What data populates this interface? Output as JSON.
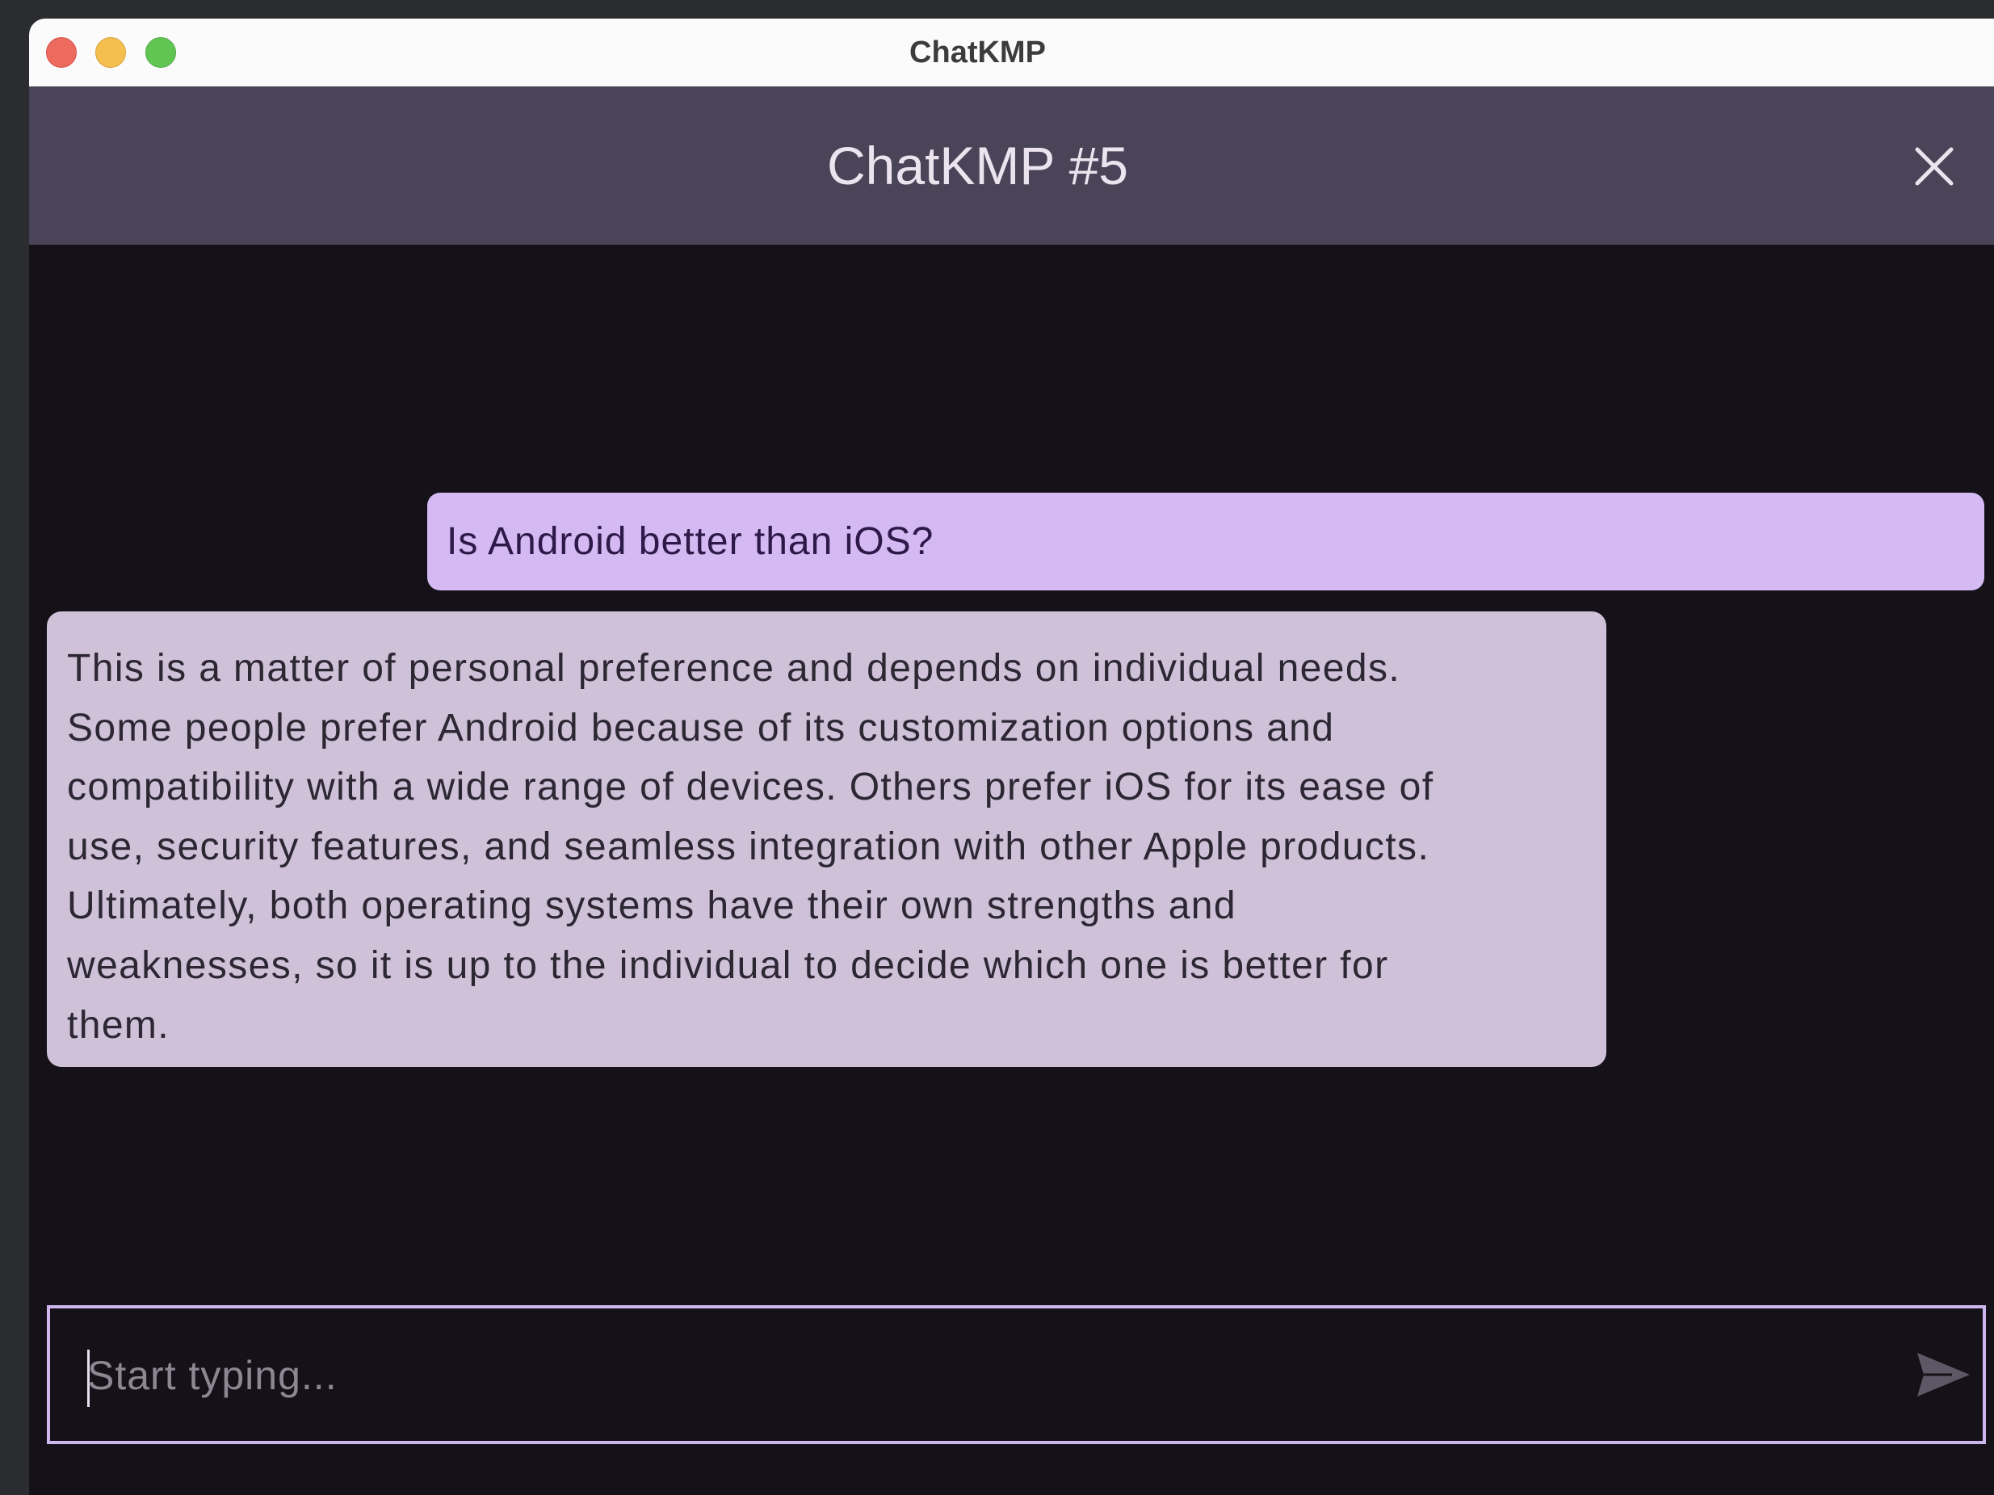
{
  "window": {
    "title": "ChatKMP"
  },
  "appbar": {
    "title": "ChatKMP #5"
  },
  "messages": [
    {
      "role": "user",
      "text": "Is Android better than iOS?"
    },
    {
      "role": "assistant",
      "lines": [
        "This is a matter of personal preference and depends on individual needs.",
        "Some people prefer Android because of its customization options and",
        "compatibility with a wide range of devices. Others prefer iOS for its ease of",
        "use, security features, and seamless integration with other Apple products.",
        "Ultimately, both operating systems have their own strengths and",
        "weaknesses, so it is up to the individual to decide which one is better for",
        "them."
      ]
    }
  ],
  "composer": {
    "placeholder": "Start typing...",
    "value": ""
  },
  "icons": {
    "close": "close-icon",
    "send": "send-icon"
  },
  "colors": {
    "appbar": "#4a4458",
    "background": "#141218",
    "user_bubble": "#d4b9f3",
    "assistant_bubble": "#cfc1d8",
    "input_border": "#cdb5ee"
  }
}
